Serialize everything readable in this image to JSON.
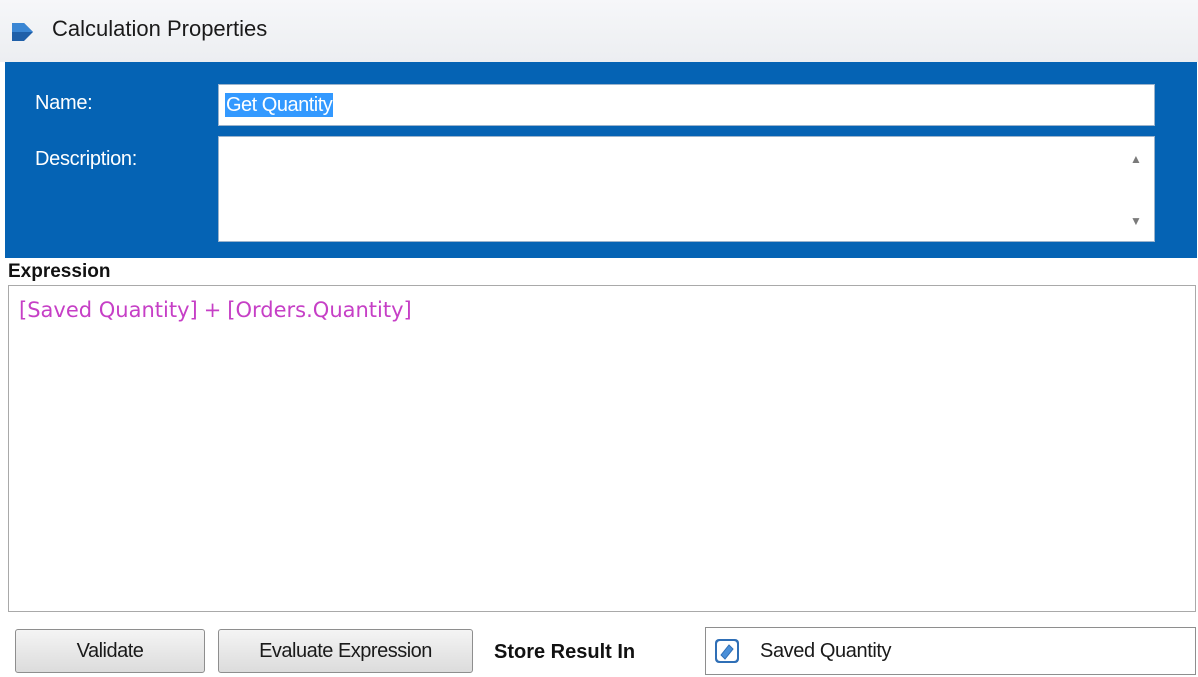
{
  "window": {
    "title": "Calculation Properties"
  },
  "form": {
    "name_label": "Name:",
    "name_value": "Get Quantity",
    "description_label": "Description:",
    "description_value": ""
  },
  "expression": {
    "label": "Expression",
    "operand_left": "[Saved Quantity]",
    "operator": "+",
    "operand_right": "[Orders.Quantity]"
  },
  "footer": {
    "validate_label": "Validate",
    "evaluate_label": "Evaluate Expression",
    "store_label": "Store Result In",
    "store_value": "Saved Quantity"
  },
  "colors": {
    "accent": "#0563b4",
    "expression_text": "#c63fc6",
    "selection": "#3399ff"
  },
  "icons": {
    "app": "blue-arrow-icon",
    "store": "variable-icon"
  }
}
